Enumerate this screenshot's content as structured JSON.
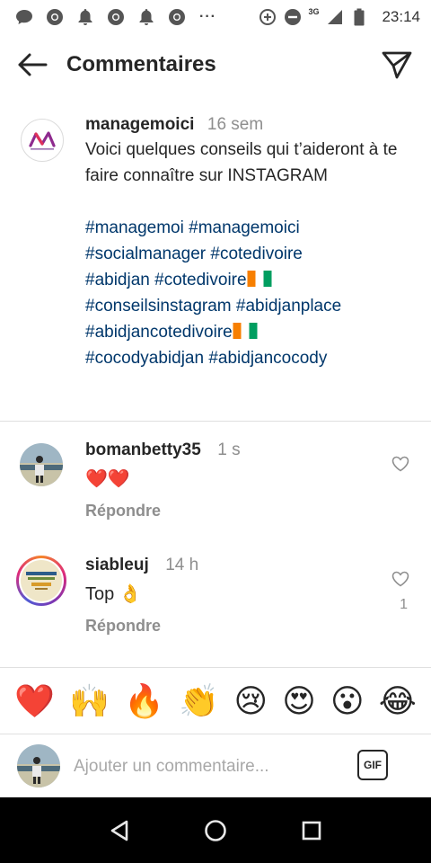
{
  "status_bar": {
    "time": "23:14",
    "network": "3G",
    "icons": [
      "chat-bubble-icon",
      "chrome-icon",
      "notification-bell-icon",
      "chrome-icon",
      "notification-bell-icon",
      "chrome-icon"
    ],
    "more": "···"
  },
  "header": {
    "title": "Commentaires"
  },
  "caption": {
    "username": "managemoici",
    "time": "16 sem",
    "text": "Voici quelques conseils qui t’aideront à te faire connaître sur INSTAGRAM",
    "hashtags": {
      "t1": "#managemoi",
      "t2": "#managemoici",
      "t3": "#socialmanager",
      "t4": "#cotedivoire",
      "t5": "#abidjan",
      "t6": "#cotedivoire",
      "t7": "#conseilsinstagram",
      "t8": "#abidjanplace",
      "t9": "#abidjancotedivoire",
      "t10": "#cocodyabidjan",
      "t11": "#abidjancocody"
    }
  },
  "comments": [
    {
      "username": "bomanbetty35",
      "time": "1 s",
      "text": "❤️❤️",
      "reply_label": "Répondre",
      "likes": ""
    },
    {
      "username": "siableuj",
      "time": "14 h",
      "text": "Top 👌",
      "reply_label": "Répondre",
      "likes": "1"
    }
  ],
  "emoji_row": [
    "❤️",
    "🙌",
    "🔥",
    "👏",
    "😢",
    "😍",
    "😮",
    "😂"
  ],
  "input": {
    "placeholder": "Ajouter un commentaire...",
    "gif_label": "GIF"
  },
  "colors": {
    "hashtag": "#00376b",
    "text": "#262626",
    "secondary": "#8e8e8e",
    "nav_bg": "#000000"
  }
}
